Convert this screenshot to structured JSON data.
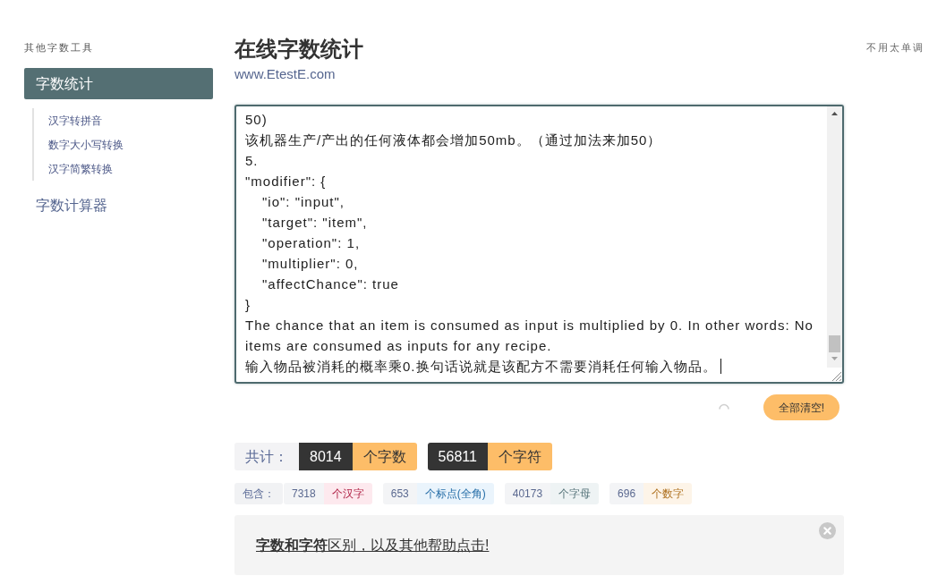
{
  "sidebar": {
    "heading": "其他字数工具",
    "items": [
      {
        "label": "字数统计",
        "selected": true,
        "children": [
          {
            "label": "汉字转拼音",
            "selected": false
          },
          {
            "label": "数字大小写转换",
            "selected": false
          },
          {
            "label": "汉字简繁转换",
            "selected": false
          }
        ]
      },
      {
        "label": "字数计算器",
        "selected": false
      }
    ]
  },
  "header": {
    "title": "在线字数统计",
    "url": "www.EtestE.com",
    "aside": "不用太单调"
  },
  "editor": {
    "lines": [
      {
        "kind": "plain",
        "text": "50)"
      },
      {
        "kind": "plain",
        "text": "该机器生产/产出的任何液体都会增加50mb。（通过加法来加50）"
      },
      {
        "kind": "plain",
        "text": "5."
      },
      {
        "kind": "plain",
        "text": "\"modifier\": {"
      },
      {
        "kind": "indented",
        "text": "\"io\": \"input\","
      },
      {
        "kind": "indented",
        "text": "\"target\": \"item\","
      },
      {
        "kind": "indented",
        "text": "\"operation\": 1,"
      },
      {
        "kind": "indented",
        "text": "\"multiplier\": 0,"
      },
      {
        "kind": "indented",
        "text": "\"affectChance\": true"
      },
      {
        "kind": "plain",
        "text": "}"
      },
      {
        "kind": "plain",
        "text": "The chance that an item is consumed as input is multiplied by 0. In other words: No items are consumed as inputs for any recipe."
      },
      {
        "kind": "plain",
        "text": "输入物品被消耗的概率乘0.换句话说就是该配方不需要消耗任何输入物品。"
      }
    ]
  },
  "clear_button": {
    "label": "全部清空!"
  },
  "totals": {
    "label": "共计：",
    "items": [
      {
        "value": "8014",
        "unit": "个字数"
      },
      {
        "value": "56811",
        "unit": "个字符"
      }
    ]
  },
  "breakdown": {
    "label": "包含：",
    "items": [
      {
        "value": "7318",
        "unit": "个汉字",
        "color": "#fde9ee"
      },
      {
        "value": "653",
        "unit": "个标点(全角)",
        "color": "#eaf4fc"
      },
      {
        "value": "40173",
        "unit": "个字母",
        "color": "#eef3f4"
      },
      {
        "value": "696",
        "unit": "个数字",
        "color": "#fdf4e8"
      }
    ]
  },
  "help": {
    "text": "**字数和字符**区别，以及其他帮助点击!"
  }
}
